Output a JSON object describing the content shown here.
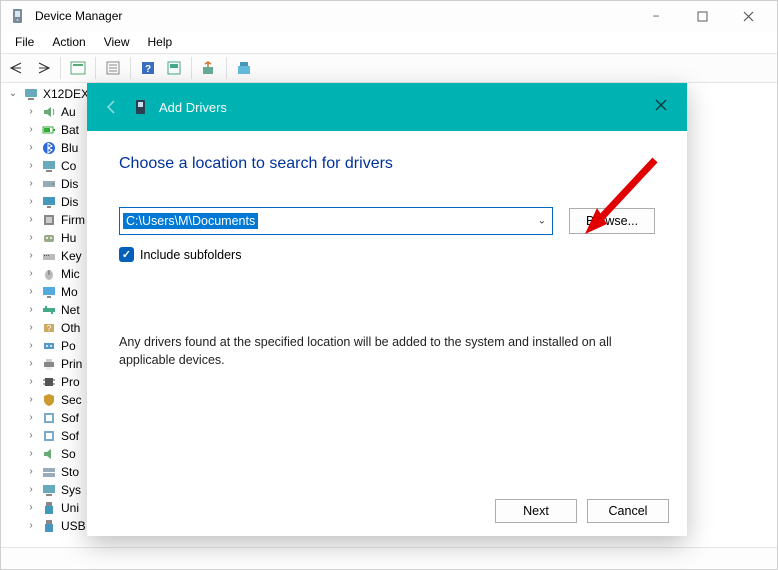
{
  "window": {
    "title": "Device Manager"
  },
  "win_controls": {
    "min": "−",
    "max": "▢",
    "close": "✕"
  },
  "menubar": [
    "File",
    "Action",
    "View",
    "Help"
  ],
  "tree": {
    "root": "X12DEX",
    "items": [
      {
        "label": "Au",
        "icon": "audio"
      },
      {
        "label": "Bat",
        "icon": "battery"
      },
      {
        "label": "Blu",
        "icon": "bluetooth"
      },
      {
        "label": "Co",
        "icon": "computer"
      },
      {
        "label": "Dis",
        "icon": "disk"
      },
      {
        "label": "Dis",
        "icon": "display"
      },
      {
        "label": "Firm",
        "icon": "firmware"
      },
      {
        "label": "Hu",
        "icon": "hid"
      },
      {
        "label": "Key",
        "icon": "keyboard"
      },
      {
        "label": "Mic",
        "icon": "mouse"
      },
      {
        "label": "Mo",
        "icon": "monitor"
      },
      {
        "label": "Net",
        "icon": "network"
      },
      {
        "label": "Oth",
        "icon": "other"
      },
      {
        "label": "Po",
        "icon": "port"
      },
      {
        "label": "Prin",
        "icon": "printer"
      },
      {
        "label": "Pro",
        "icon": "processor"
      },
      {
        "label": "Sec",
        "icon": "security"
      },
      {
        "label": "Sof",
        "icon": "software"
      },
      {
        "label": "Sof",
        "icon": "software2"
      },
      {
        "label": "So",
        "icon": "sound"
      },
      {
        "label": "Sto",
        "icon": "storage"
      },
      {
        "label": "Sys",
        "icon": "system"
      },
      {
        "label": "Uni",
        "icon": "usb"
      },
      {
        "label": "USB",
        "icon": "usb2"
      }
    ]
  },
  "dialog": {
    "title": "Add Drivers",
    "heading": "Choose a location to search for drivers",
    "path_value": "C:\\Users\\M\\Documents",
    "include_subfolders": "Include subfolders",
    "include_subfolders_checked": true,
    "browse": "Browse...",
    "description": "Any drivers found at the specified location will be added to the system and installed on all applicable devices.",
    "next": "Next",
    "cancel": "Cancel"
  }
}
